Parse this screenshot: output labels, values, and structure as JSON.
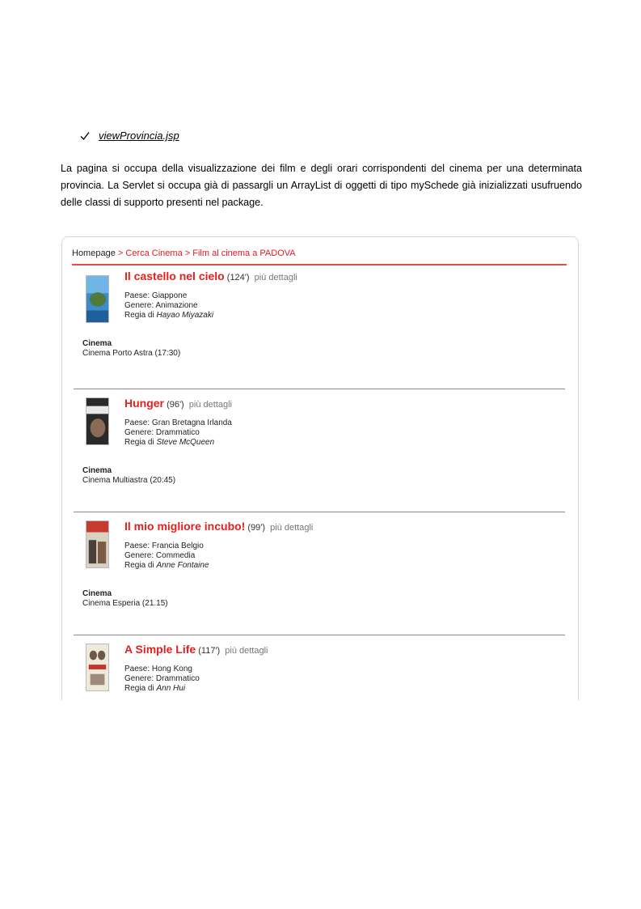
{
  "bullet": {
    "file_name": "viewProvincia.jsp"
  },
  "paragraph": "La pagina si occupa della visualizzazione dei film e degli orari corrispondenti del cinema per una determinata provincia. La Servlet si occupa già di passargli un ArrayList di oggetti di tipo mySchede già inizializzati usufruendo delle classi di supporto presenti nel package.",
  "breadcrumb": {
    "home": "Homepage",
    "sep": ">",
    "search": "Cerca Cinema",
    "current": "Film al cinema a PADOVA"
  },
  "labels": {
    "more": "più dettagli",
    "country_prefix": "Paese: ",
    "genre_prefix": "Genere: ",
    "director_prefix": "Regia di ",
    "cinema_label": "Cinema"
  },
  "films": [
    {
      "title": "Il castello nel cielo",
      "duration": "(124')",
      "country": "Giappone",
      "genre": "Animazione",
      "director": "Hayao Miyazaki",
      "showing": "Cinema Porto Astra (17:30)"
    },
    {
      "title": "Hunger",
      "duration": "(96')",
      "country": "Gran Bretagna Irlanda",
      "genre": "Drammatico",
      "director": "Steve McQueen",
      "showing": "Cinema Multiastra (20:45)"
    },
    {
      "title": "Il mio migliore incubo!",
      "duration": "(99')",
      "country": "Francia Belgio",
      "genre": "Commedia",
      "director": "Anne Fontaine",
      "showing": "Cinema Esperia (21.15)"
    },
    {
      "title": "A Simple Life",
      "duration": "(117')",
      "country": "Hong Kong",
      "genre": "Drammatico",
      "director": "Ann Hui",
      "showing": ""
    }
  ],
  "colors": {
    "accent": "#e5201e",
    "rule": "#e84b45"
  }
}
